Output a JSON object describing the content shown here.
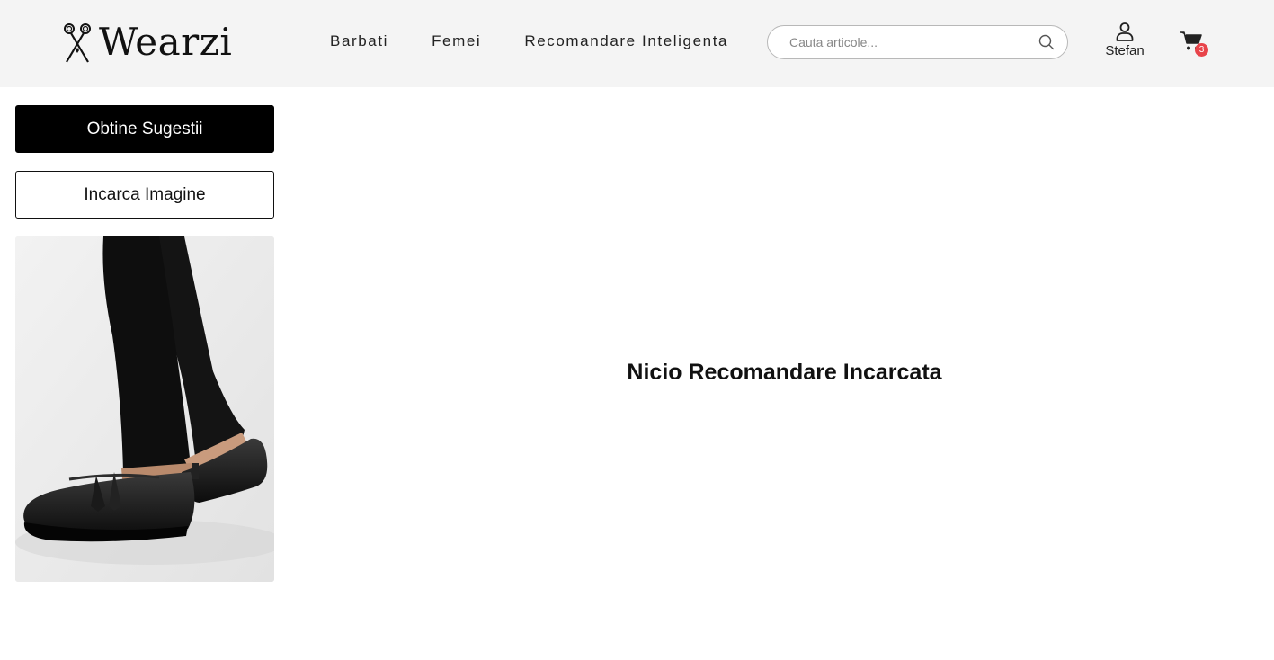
{
  "header": {
    "logo_text": "Wearzi",
    "nav": [
      "Barbati",
      "Femei",
      "Recomandare Inteligenta"
    ],
    "search": {
      "placeholder": "Cauta articole...",
      "value": ""
    },
    "user": {
      "name": "Stefan"
    },
    "cart": {
      "count": "3",
      "badge_color": "#e8444a"
    }
  },
  "sidebar": {
    "suggest_button": "Obtine Sugestii",
    "upload_button": "Incarca Imagine",
    "uploaded_image": "black-tassel-loafers-photo"
  },
  "main": {
    "empty_message": "Nicio Recomandare Incarcata"
  },
  "colors": {
    "header_bg": "#f4f4f4",
    "primary_button": "#000000",
    "accent_badge": "#e8444a"
  }
}
